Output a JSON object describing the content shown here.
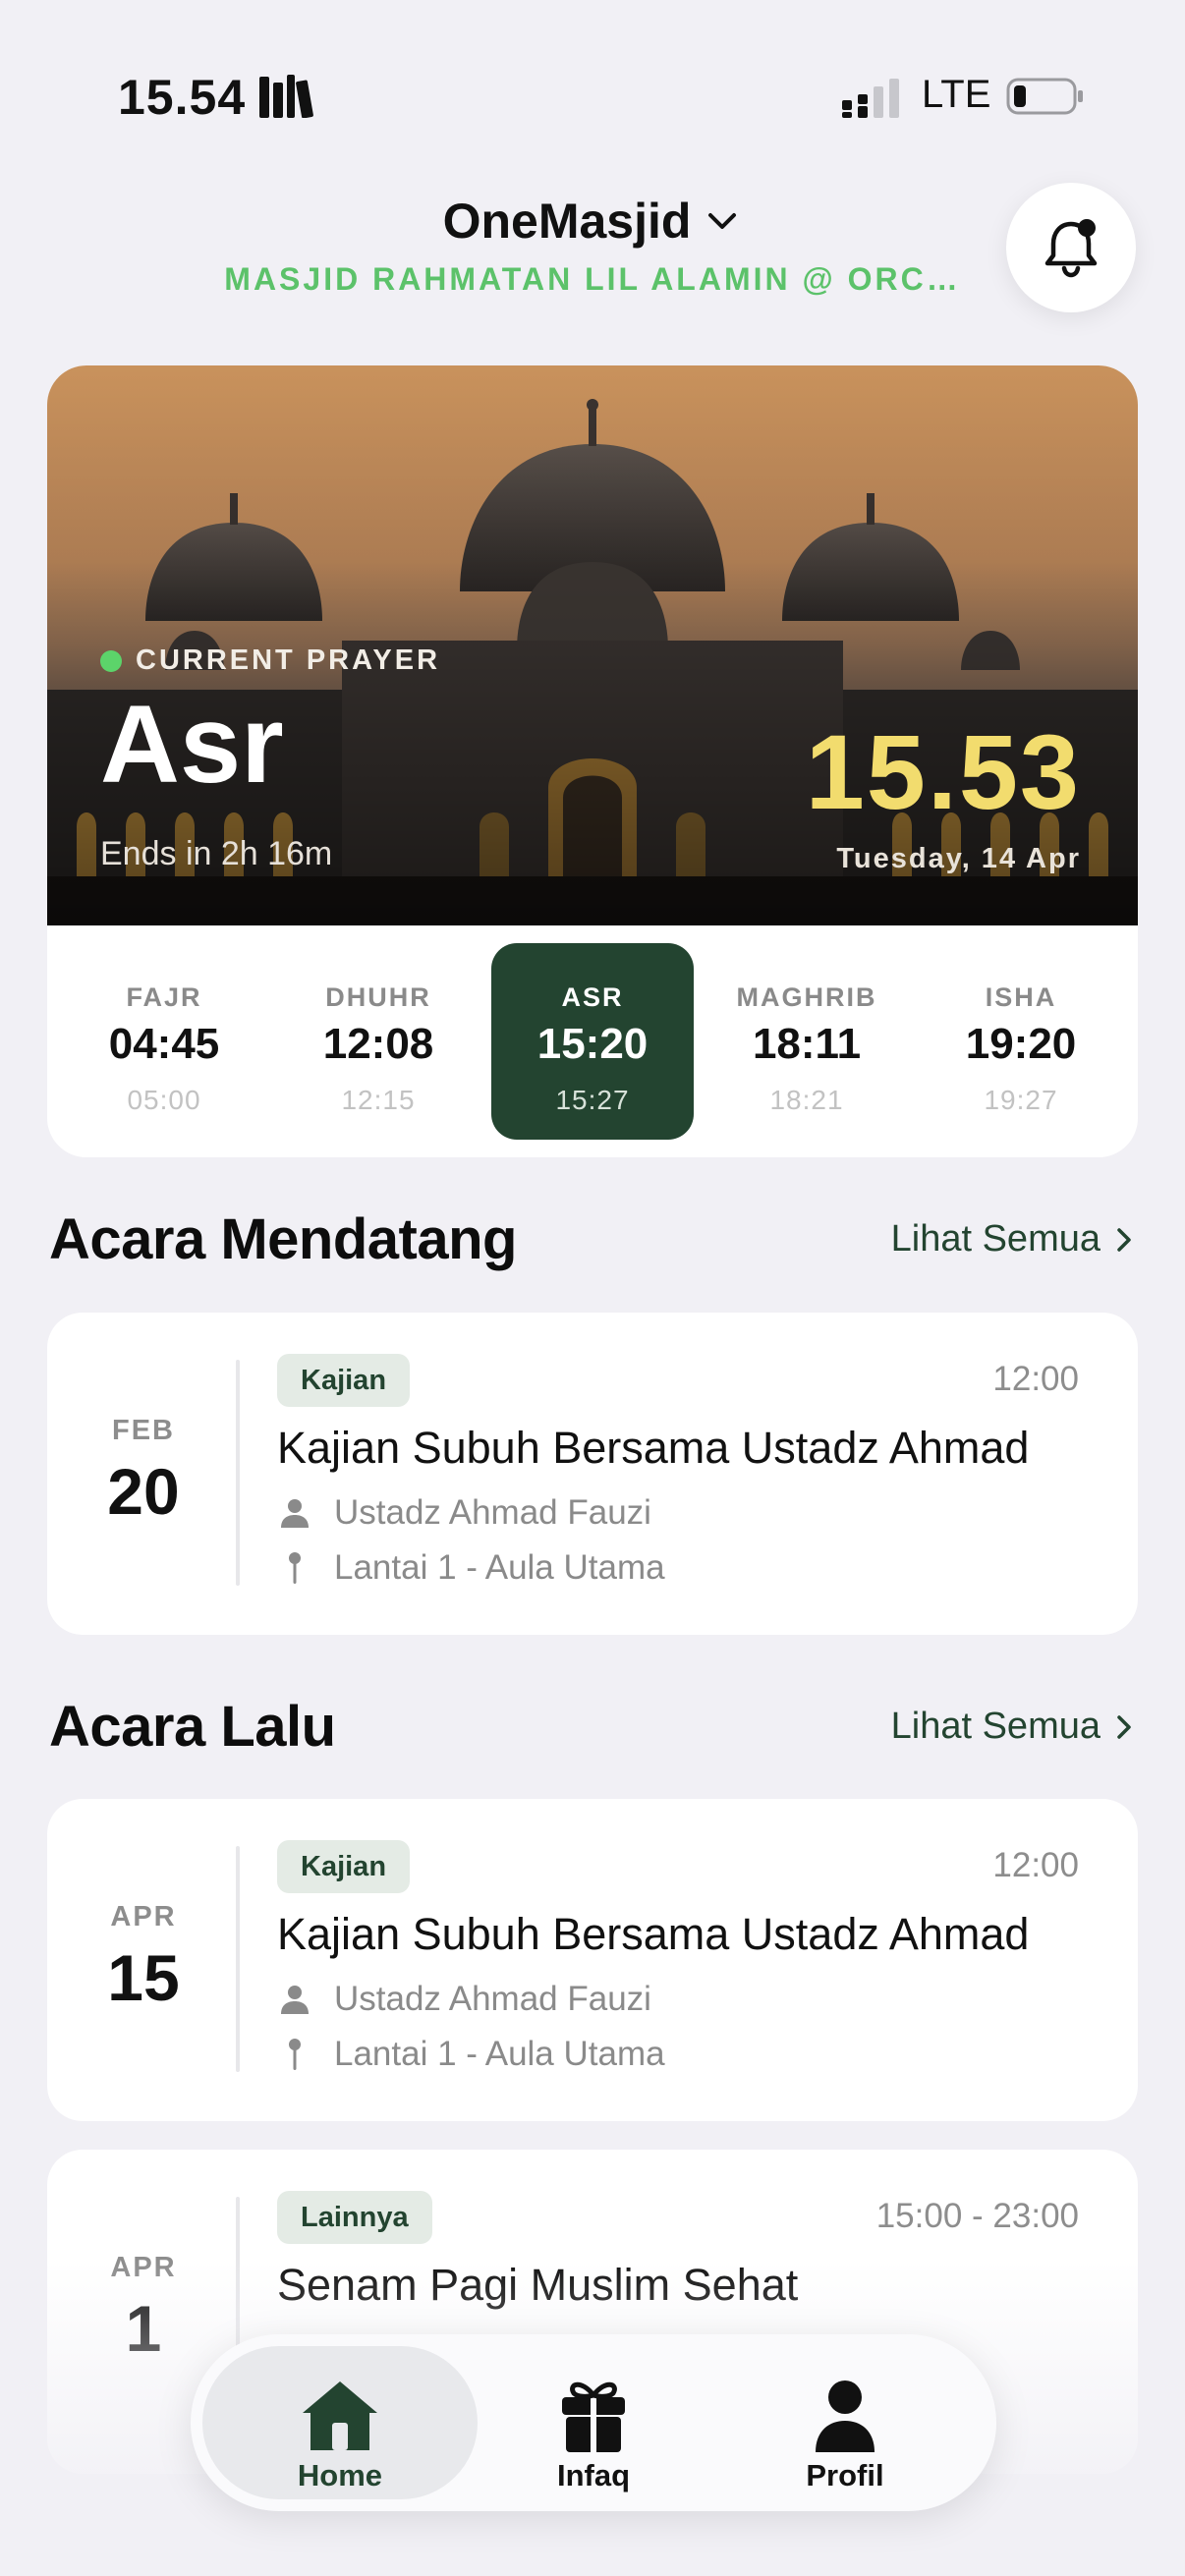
{
  "status_bar": {
    "time": "15.54",
    "network": "LTE"
  },
  "header": {
    "app_title": "OneMasjid",
    "masjid_name": "MASJID RAHMATAN LIL ALAMIN @ ORC…"
  },
  "current_prayer": {
    "label": "CURRENT PRAYER",
    "name": "Asr",
    "ends_in": "Ends in 2h 16m",
    "clock": "15.53",
    "date": "Tuesday, 14 Apr"
  },
  "prayers": [
    {
      "name": "FAJR",
      "time": "04:45",
      "iqamah": "05:00",
      "active": false
    },
    {
      "name": "DHUHR",
      "time": "12:08",
      "iqamah": "12:15",
      "active": false
    },
    {
      "name": "ASR",
      "time": "15:20",
      "iqamah": "15:27",
      "active": true
    },
    {
      "name": "MAGHRIB",
      "time": "18:11",
      "iqamah": "18:21",
      "active": false
    },
    {
      "name": "ISHA",
      "time": "19:20",
      "iqamah": "19:27",
      "active": false
    }
  ],
  "upcoming": {
    "title": "Acara Mendatang",
    "see_all": "Lihat Semua",
    "events": [
      {
        "month": "FEB",
        "day": "20",
        "tag": "Kajian",
        "time": "12:00",
        "title": "Kajian Subuh Bersama Ustadz Ahmad",
        "speaker": "Ustadz Ahmad Fauzi",
        "location": "Lantai 1 - Aula Utama"
      }
    ]
  },
  "past": {
    "title": "Acara Lalu",
    "see_all": "Lihat Semua",
    "events": [
      {
        "month": "APR",
        "day": "15",
        "tag": "Kajian",
        "time": "12:00",
        "title": "Kajian Subuh Bersama Ustadz Ahmad",
        "speaker": "Ustadz Ahmad Fauzi",
        "location": "Lantai 1 - Aula Utama"
      },
      {
        "month": "APR",
        "day": "1",
        "tag": "Lainnya",
        "time": "15:00 - 23:00",
        "title": "Senam Pagi Muslim Sehat"
      }
    ]
  },
  "tab_bar": {
    "tabs": [
      {
        "label": "Home",
        "icon": "home-icon",
        "active": true
      },
      {
        "label": "Infaq",
        "icon": "gift-icon",
        "active": false
      },
      {
        "label": "Profil",
        "icon": "person-icon",
        "active": false
      }
    ]
  },
  "colors": {
    "accent": "#234430",
    "brand_green": "#5cc26a",
    "clock_gold": "#f2dc6e",
    "background": "#f1f0f5"
  }
}
